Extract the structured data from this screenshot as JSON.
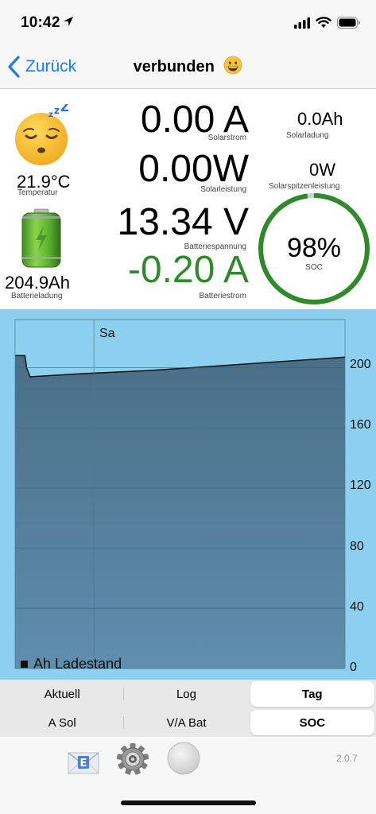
{
  "status": {
    "time": "10:42"
  },
  "nav": {
    "back_label": "Zurück",
    "title": "verbunden"
  },
  "dashboard": {
    "temperature": {
      "value": "21.9°C",
      "label": "Temperatur"
    },
    "battery_charge": {
      "value": "204.9Ah",
      "label": "Batterieladung"
    },
    "solar_current": {
      "value": "0.00 A",
      "label": "Solarstrom"
    },
    "solar_power": {
      "value": "0.00W",
      "label": "Solarleistung"
    },
    "battery_voltage": {
      "value": "13.34 V",
      "label": "Batteriespannung"
    },
    "battery_current": {
      "value": "-0.20 A",
      "label": "Batteriestrom"
    },
    "solar_charge": {
      "value": "0.0Ah",
      "label": "Solarladung"
    },
    "solar_peak_power": {
      "value": "0W",
      "label": "Solarspitzenleistung"
    },
    "soc": {
      "value": "98%",
      "label": "SOC",
      "fraction": 0.98
    }
  },
  "colors": {
    "accent": "#1a7cf5",
    "green": "#2f8a2c",
    "chart_bg": "#8ccfee",
    "chart_fill": "#4d7590"
  },
  "chart_data": {
    "type": "area",
    "day_label": "Sa",
    "y_ticks": [
      "200",
      "160",
      "120",
      "80",
      "40",
      "0"
    ],
    "ylim": [
      0,
      232
    ],
    "x": [
      0,
      0.03,
      0.035,
      0.045,
      0.05,
      0.2,
      0.4,
      0.6,
      0.8,
      1.0
    ],
    "values": [
      208,
      208,
      200,
      194,
      194,
      196,
      198,
      201,
      204,
      207
    ],
    "legend": "Ah Ladestand",
    "grid": true
  },
  "segments": {
    "row1": [
      {
        "label": "Aktuell",
        "selected": false
      },
      {
        "label": "Log",
        "selected": false
      },
      {
        "label": "Tag",
        "selected": true
      }
    ],
    "row2": [
      {
        "label": "A Sol",
        "selected": false
      },
      {
        "label": "V/A Bat",
        "selected": false
      },
      {
        "label": "SOC",
        "selected": true
      }
    ]
  },
  "toolbar": {
    "version": "2.0.7",
    "email_icon": "email-icon",
    "settings_icon": "gear-icon",
    "status_icon": "status-circle-icon"
  }
}
